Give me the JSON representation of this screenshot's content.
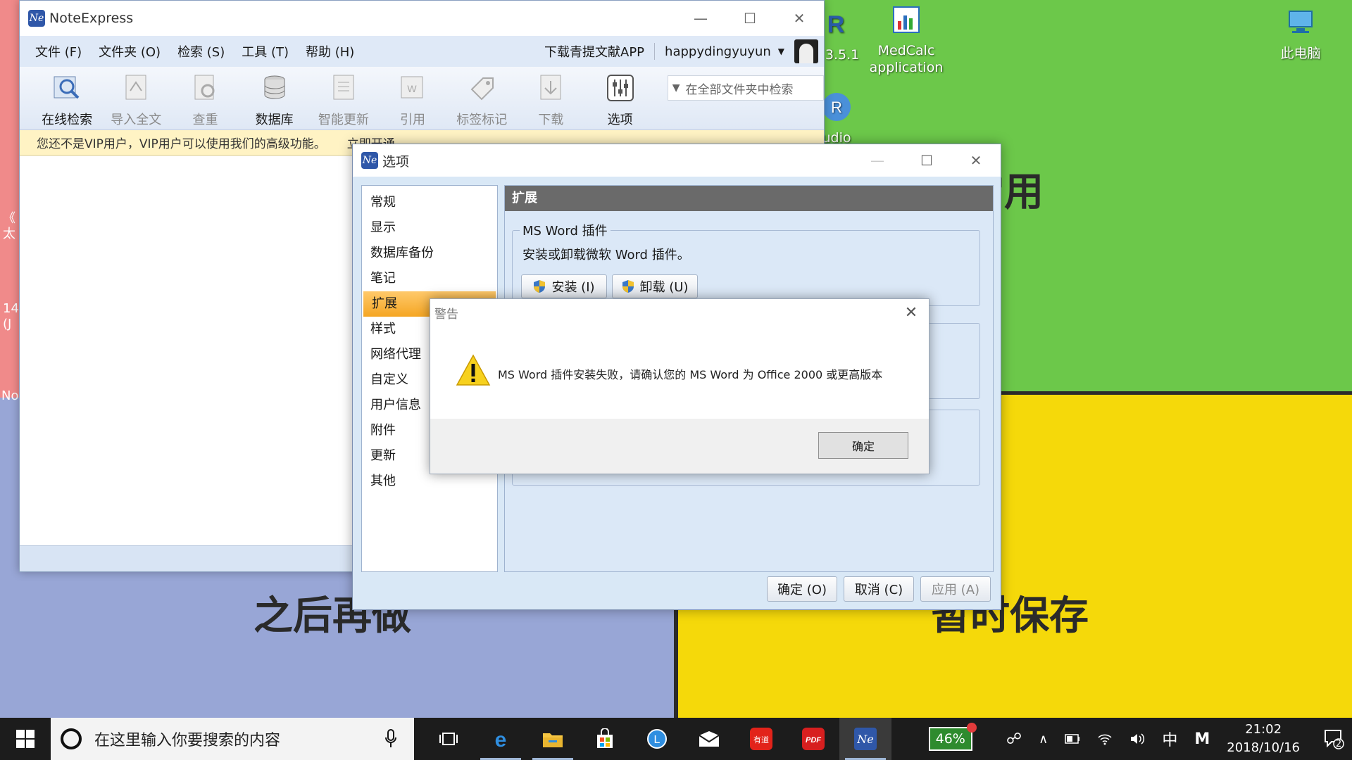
{
  "desktop": {
    "bg_text_top_right": "常用",
    "bg_text_bottom_left": "之后再做",
    "bg_text_bottom_right": "暂时保存",
    "icons": [
      {
        "label": "4 3.5.1"
      },
      {
        "label": "MedCalc application"
      },
      {
        "label": "此电脑"
      },
      {
        "label": "udio"
      }
    ],
    "edge_text": [
      "《",
      "太",
      "14",
      "(J",
      "No"
    ]
  },
  "main_window": {
    "title": "NoteExpress",
    "menu": [
      "文件 (F)",
      "文件夹 (O)",
      "检索 (S)",
      "工具 (T)",
      "帮助 (H)"
    ],
    "download_app": "下载青提文献APP",
    "username": "happydingyuyun",
    "toolbar": [
      {
        "label": "在线检索",
        "enabled": true
      },
      {
        "label": "导入全文",
        "enabled": false
      },
      {
        "label": "查重",
        "enabled": false
      },
      {
        "label": "数据库",
        "enabled": true
      },
      {
        "label": "智能更新",
        "enabled": false
      },
      {
        "label": "引用",
        "enabled": false
      },
      {
        "label": "标签标记",
        "enabled": false
      },
      {
        "label": "下载",
        "enabled": false
      },
      {
        "label": "选项",
        "enabled": true
      }
    ],
    "search_placeholder": "在全部文件夹中检索",
    "vip_notice": "您还不是VIP用户，VIP用户可以使用我们的高级功能。",
    "vip_link": "立即开通"
  },
  "options_dialog": {
    "title": "选项",
    "nav": [
      "常规",
      "显示",
      "数据库备份",
      "笔记",
      "扩展",
      "样式",
      "网络代理",
      "自定义",
      "用户信息",
      "附件",
      "更新",
      "其他"
    ],
    "active_nav": "扩展",
    "panel_title": "扩展",
    "group_title": "MS Word 插件",
    "group_desc": "安装或卸载微软 Word 插件。",
    "install_label": "安装 (I)",
    "uninstall_label": "卸载 (U)",
    "ok_label": "确定 (O)",
    "cancel_label": "取消 (C)",
    "apply_label": "应用 (A)"
  },
  "warning_dialog": {
    "title": "警告",
    "message": "MS Word 插件安装失败，请确认您的 MS Word 为 Office 2000 或更高版本",
    "ok_label": "确定"
  },
  "taskbar": {
    "search_placeholder": "在这里输入你要搜索的内容",
    "battery": "46%",
    "ime": "中",
    "ime_mode": "M",
    "time": "21:02",
    "date": "2018/10/16",
    "notification_count": "2"
  },
  "colors": {
    "quad_red": "#f08a8a",
    "quad_green": "#6cc84a",
    "quad_blue": "#98a6d6",
    "quad_yellow": "#f5d90a",
    "nav_active": "#f5a623",
    "app_blue": "#2f57a8"
  }
}
